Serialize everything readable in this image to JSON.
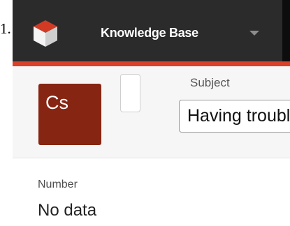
{
  "list_marker": "1.",
  "topbar": {
    "app_icon": "cube-logo-icon",
    "title": "Knowledge Base",
    "dropdown_icon": "chevron-down-icon"
  },
  "record": {
    "avatar_text": "Cs",
    "subject_label": "Subject",
    "subject_value": "Having trouble"
  },
  "fields": {
    "number_label": "Number",
    "number_value": "No data"
  },
  "colors": {
    "topbar": "#2b2b2b",
    "accent": "#d9412a",
    "avatar": "#862511"
  }
}
